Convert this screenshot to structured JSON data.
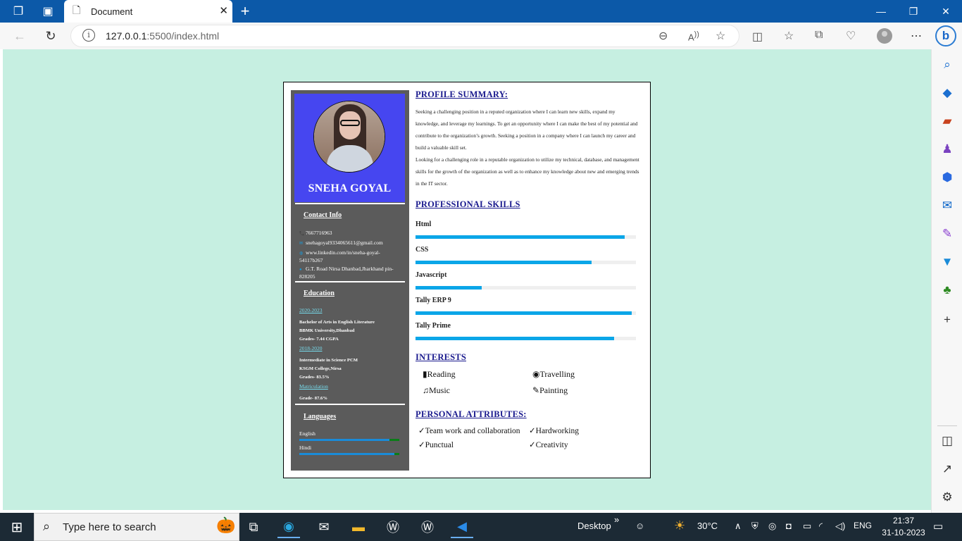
{
  "browser": {
    "tab_title": "Document",
    "url_host": "127.0.0.1",
    "url_rest": ":5500/index.html",
    "new_tab": "+",
    "close_tab": "✕",
    "bing": "b"
  },
  "resume": {
    "name": "SNEHA GOYAL",
    "contact": {
      "heading": "Contact Info",
      "phone": "7667716963",
      "email": "snehagoyal9334065611@gmail.com",
      "linkedin": "www.linkedin.com/in/sneha-goyal-54117b267",
      "address": "G.T. Road Nirsa Dhanbad,Jharkhand pin-828205"
    },
    "education": {
      "heading": "Education",
      "e1_years": "2020-2023",
      "e1_degree": "Bachelor of Arts in English Literature",
      "e1_school": "BBMK University,Dhanbad",
      "e1_grade": "Grades- 7.44 CGPA",
      "e2_years": "2018-2020",
      "e2_degree": "Intermediate in Science PCM",
      "e2_school": "KSGM College,Nirsa",
      "e2_grade": "Grades- 83.5%",
      "e3_label": "Matriculation",
      "e3_grade": "Grade- 87.6%"
    },
    "languages": {
      "heading": "Languages",
      "items": [
        {
          "name": "English",
          "level": 0.9
        },
        {
          "name": "Hindi",
          "level": 0.95
        }
      ]
    },
    "profile": {
      "heading": "PROFILE SUMMARY:",
      "text1": "Seeking a challenging position in a reputed organization where I can learn new skills, expand my knowledge, and leverage my learnings. To get an opportunity where I can make the best of my potential and contribute to the organization’s growth. Seeking a position in a company where I can launch my career and build a valuable skill set.",
      "text2": "Looking for a challenging role in a reputable organization to utilize my technical, database, and management skills for the growth of the organization as well as to enhance my knowledge about new and emerging trends in the IT sector."
    },
    "skills": {
      "heading": "PROFESSIONAL SKILLS",
      "items": [
        {
          "name": "Html",
          "level": 0.95
        },
        {
          "name": "CSS",
          "level": 0.8
        },
        {
          "name": "Javascript",
          "level": 0.3
        },
        {
          "name": "Tally ERP 9",
          "level": 0.98
        },
        {
          "name": "Tally Prime",
          "level": 0.9
        }
      ]
    },
    "interests": {
      "heading": "INTERESTS",
      "items": [
        "Reading",
        "Travelling",
        "Music",
        "Painting"
      ]
    },
    "attributes": {
      "heading": "PERSONAL ATTRIBUTES:",
      "items": [
        "Team work and collaboration",
        "Hardworking",
        "Punctual",
        "Creativity"
      ]
    }
  },
  "taskbar": {
    "search_placeholder": "Type here to search",
    "desktop": "Desktop",
    "chevron": "»",
    "temperature": "30°C",
    "lang": "ENG",
    "time": "21:37",
    "date": "31-10-2023"
  },
  "colors": {
    "page_bg": "#c6efe1",
    "sidebar_bg": "#5b5b5b",
    "photo_bg": "#4646f0",
    "heading": "#1a1a8e",
    "skill_bar": "#0ba6e8",
    "browser_blue": "#0c59a8"
  }
}
